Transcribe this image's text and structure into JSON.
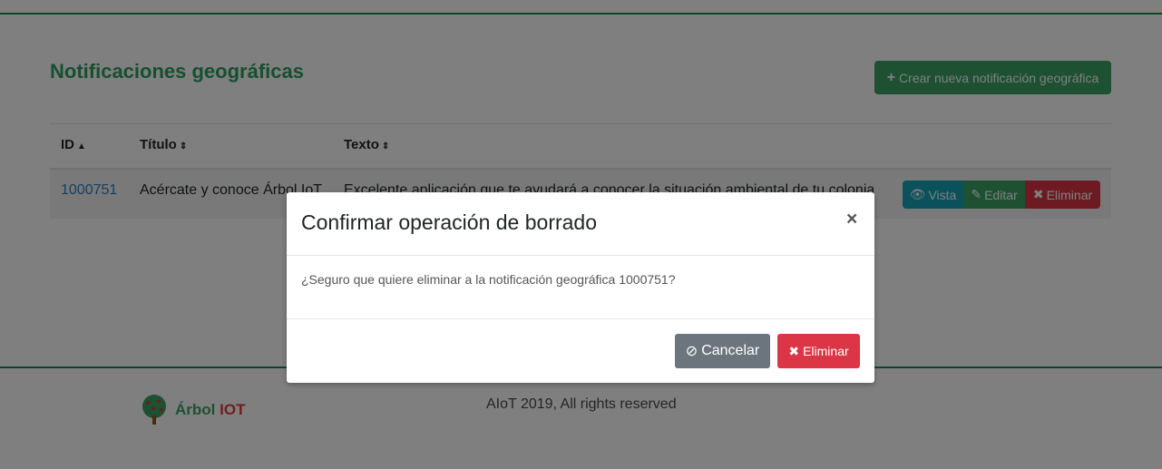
{
  "header": {
    "title": "Notificaciones geográficas",
    "create_label": "Crear nueva notificación geográfica"
  },
  "table": {
    "columns": [
      {
        "label": "ID",
        "sort": "▲"
      },
      {
        "label": "Título",
        "sort": "⇕"
      },
      {
        "label": "Texto",
        "sort": "⇕"
      }
    ],
    "rows": [
      {
        "id": "1000751",
        "title": "Acércate y conoce Árbol IoT",
        "text": "Excelente aplicación que te ayudará a conocer la situación ambiental de tu colonia",
        "actions": {
          "view": "Vista",
          "edit": "Editar",
          "delete": "Eliminar"
        }
      }
    ]
  },
  "footer": {
    "logo_part1": "Árbol",
    "logo_part2": "IOT",
    "copyright": "AIoT 2019, All rights reserved"
  },
  "modal": {
    "title": "Confirmar operación de borrado",
    "close": "×",
    "body": "¿Seguro que quiere eliminar a la notificación geográfica 1000751?",
    "cancel_label": "Cancelar",
    "delete_label": "Eliminar"
  },
  "icons": {
    "plus": "+",
    "eye": "👁",
    "pencil": "✎",
    "x": "✖",
    "ban": "⊘"
  },
  "colors": {
    "brand_green": "#2e9e5e",
    "danger": "#dc3545",
    "info": "#17a2b8",
    "secondary": "#6c757d"
  }
}
